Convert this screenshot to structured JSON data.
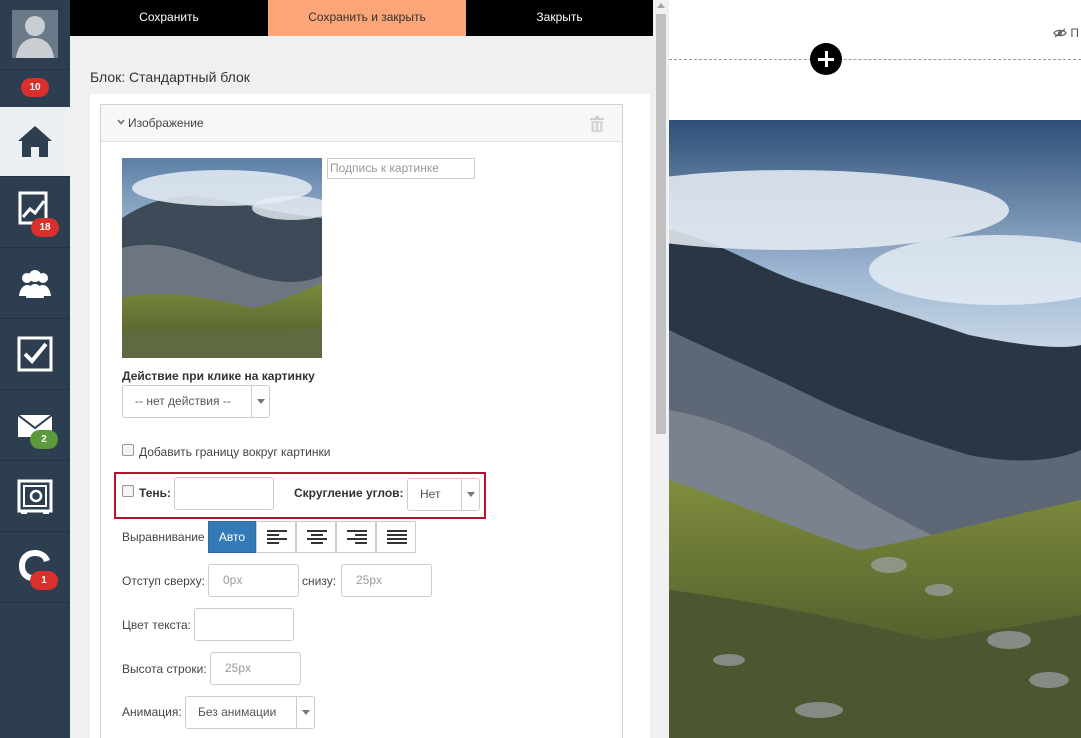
{
  "sidebar": {
    "badges": {
      "profile": "10",
      "analytics": "18",
      "mail": "2",
      "chat": "1"
    },
    "items": [
      {
        "name": "home-icon"
      },
      {
        "name": "analytics-icon"
      },
      {
        "name": "users-icon"
      },
      {
        "name": "tasks-icon"
      },
      {
        "name": "mail-icon"
      },
      {
        "name": "settings-icon"
      },
      {
        "name": "chat-icon"
      }
    ]
  },
  "toolbar": {
    "save_label": "Сохранить",
    "save_close_label": "Сохранить и закрыть",
    "close_label": "Закрыть"
  },
  "editor": {
    "block_title": "Блок: Стандартный блок",
    "section_title": "Изображение",
    "caption_placeholder": "Подпись к картинке",
    "click_action_label": "Действие при клике на картинку",
    "click_action_value": "-- нет действия --",
    "border_checkbox_label": "Добавить границу вокруг картинки",
    "shadow_label": "Тень:",
    "corner_label": "Скругление углов:",
    "corner_value": "Нет",
    "alignment_label": "Выравнивание",
    "alignment_auto": "Авто",
    "margin_top_label": "Отступ сверху:",
    "margin_top_placeholder": "0px",
    "margin_bottom_label": "снизу:",
    "margin_bottom_placeholder": "25px",
    "text_color_label": "Цвет текста:",
    "line_height_label": "Высота строки:",
    "line_height_placeholder": "25px",
    "animation_label": "Анимация:",
    "animation_value": "Без анимации"
  },
  "preview": {
    "eye_text": "П"
  },
  "colors": {
    "sidebar_bg": "#2d3e50",
    "highlight_button": "#fba578",
    "highlight_border": "#b0142b",
    "accent_blue": "#337ab7"
  }
}
